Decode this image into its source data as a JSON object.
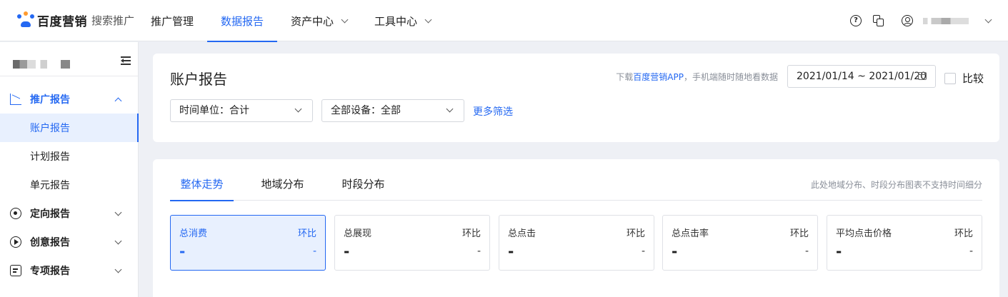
{
  "brand": {
    "name": "百度营销",
    "product": "搜索推广",
    "accent": "#2468f2"
  },
  "nav": {
    "items": [
      "推广管理",
      "数据报告",
      "资产中心",
      "工具中心"
    ],
    "active": "数据报告"
  },
  "topbar_icons": [
    "help-icon",
    "copy-icon",
    "user-icon",
    "chevron-down-icon"
  ],
  "sidebar": {
    "groups": [
      {
        "label": "推广报告",
        "icon": "line-chart-icon",
        "open": true,
        "items": [
          "账户报告",
          "计划报告",
          "单元报告"
        ],
        "active_item": "账户报告"
      },
      {
        "label": "定向报告",
        "icon": "target-icon",
        "open": false
      },
      {
        "label": "创意报告",
        "icon": "play-circle-icon",
        "open": false
      },
      {
        "label": "专项报告",
        "icon": "document-icon",
        "open": false
      }
    ]
  },
  "header": {
    "title": "账户报告",
    "tip_prefix": "下载",
    "tip_link": "百度营销APP",
    "tip_suffix": "，手机端随时随地看数据",
    "date_range": "2021/01/14 ~ 2021/01/20",
    "compare_label": "比较",
    "compare_checked": false
  },
  "filters": {
    "time_unit": "时间单位：合计",
    "device": "全部设备：全部",
    "more": "更多筛选"
  },
  "tabs": {
    "items": [
      "整体走势",
      "地域分布",
      "时段分布"
    ],
    "active": "整体走势",
    "note": "此处地域分布、时段分布图表不支持时间细分"
  },
  "metrics": [
    {
      "name": "总消费",
      "compare_label": "环比",
      "value": "-",
      "rate": "-",
      "active": true
    },
    {
      "name": "总展现",
      "compare_label": "环比",
      "value": "-",
      "rate": "-",
      "active": false
    },
    {
      "name": "总点击",
      "compare_label": "环比",
      "value": "-",
      "rate": "-",
      "active": false
    },
    {
      "name": "总点击率",
      "compare_label": "环比",
      "value": "-",
      "rate": "-",
      "active": false
    },
    {
      "name": "平均点击价格",
      "compare_label": "环比",
      "value": "-",
      "rate": "-",
      "active": false
    }
  ]
}
